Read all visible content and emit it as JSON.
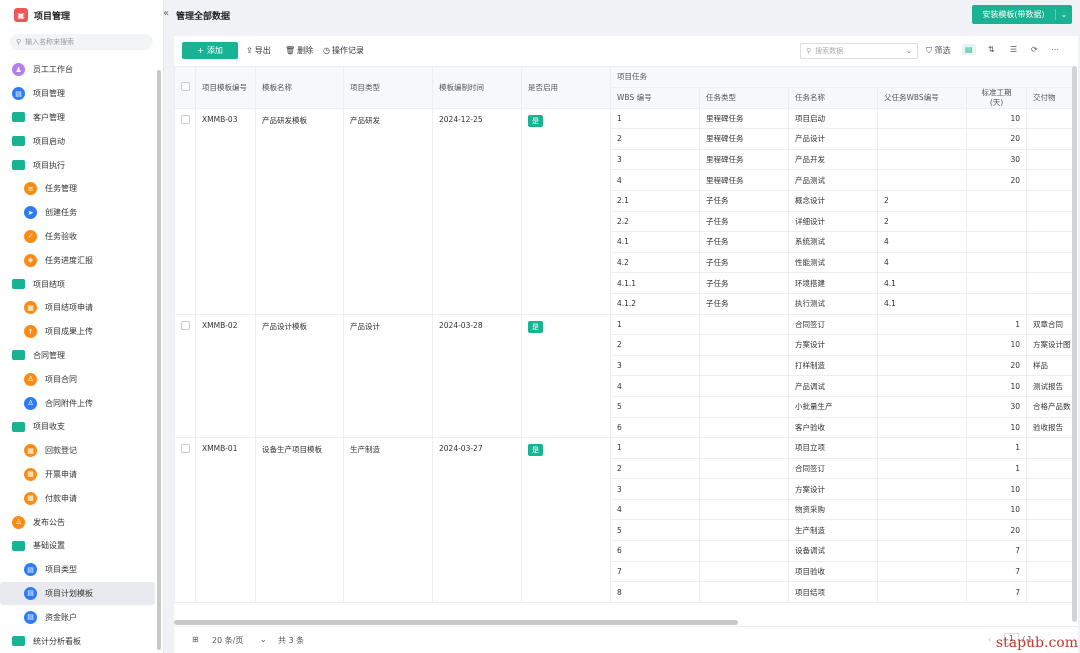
{
  "app": {
    "title": "项目管理",
    "logo_icon": "app-logo-icon"
  },
  "sidebar": {
    "search_placeholder": "输入名称来搜索",
    "items": [
      {
        "label": "员工工作台",
        "icon": "user-icon",
        "color": "purple",
        "level": 0
      },
      {
        "label": "项目管理",
        "icon": "document-icon",
        "color": "blue",
        "level": 0
      },
      {
        "label": "客户管理",
        "icon": "folder-icon",
        "color": "folder",
        "level": 0
      },
      {
        "label": "项目启动",
        "icon": "folder-icon",
        "color": "folder",
        "level": 0
      },
      {
        "label": "项目执行",
        "icon": "folder-icon",
        "color": "folder",
        "level": 0
      },
      {
        "label": "任务管理",
        "icon": "list-icon",
        "color": "orange",
        "level": 1
      },
      {
        "label": "创建任务",
        "icon": "send-icon",
        "color": "blue",
        "level": 1
      },
      {
        "label": "任务验收",
        "icon": "check-icon",
        "color": "orange",
        "level": 1
      },
      {
        "label": "任务进度汇报",
        "icon": "shield-icon",
        "color": "orange",
        "level": 1
      },
      {
        "label": "项目结项",
        "icon": "folder-icon",
        "color": "folder",
        "level": 0
      },
      {
        "label": "项目结项申请",
        "icon": "form-icon",
        "color": "orange",
        "level": 1
      },
      {
        "label": "项目成果上传",
        "icon": "upload-icon",
        "color": "orange",
        "level": 1
      },
      {
        "label": "合同管理",
        "icon": "folder-icon",
        "color": "folder",
        "level": 0
      },
      {
        "label": "项目合同",
        "icon": "person-icon",
        "color": "orange",
        "level": 1
      },
      {
        "label": "合同附件上传",
        "icon": "person-icon",
        "color": "blue",
        "level": 1
      },
      {
        "label": "项目收支",
        "icon": "folder-icon",
        "color": "folder",
        "level": 0
      },
      {
        "label": "回款登记",
        "icon": "form-icon",
        "color": "orange",
        "level": 1
      },
      {
        "label": "开票申请",
        "icon": "form-icon",
        "color": "orange",
        "level": 1
      },
      {
        "label": "付款申请",
        "icon": "form-icon",
        "color": "orange",
        "level": 1
      },
      {
        "label": "发布公告",
        "icon": "person-icon",
        "color": "orange",
        "level": 0
      },
      {
        "label": "基础设置",
        "icon": "folder-icon",
        "color": "folder",
        "level": 0
      },
      {
        "label": "项目类型",
        "icon": "document-icon",
        "color": "blue",
        "level": 1
      },
      {
        "label": "项目计划模板",
        "icon": "document-icon",
        "color": "blue",
        "level": 1,
        "active": true
      },
      {
        "label": "资金账户",
        "icon": "document-icon",
        "color": "blue",
        "level": 1
      },
      {
        "label": "统计分析看板",
        "icon": "folder-icon",
        "color": "folder",
        "level": 0
      }
    ]
  },
  "header": {
    "collapse_glyph": "«",
    "title": "管理全部数据",
    "install_button": "安装模板(带数据)"
  },
  "toolbar": {
    "add": "添加",
    "export": "导出",
    "delete": "删除",
    "log": "操作记录",
    "search_placeholder": "搜索数据",
    "filter": "筛选"
  },
  "table": {
    "headers": {
      "code": "项目模板编号",
      "name": "模板名称",
      "type": "项目类型",
      "date": "模板编制时间",
      "enabled": "是否启用",
      "group": "项目任务",
      "wbs": "WBS 编号",
      "task_type": "任务类型",
      "task_name": "任务名称",
      "parent_wbs": "父任务WBS编号",
      "duration": "标准工期\n(天)",
      "deliverable": "交付物"
    },
    "records": [
      {
        "code": "XMMB-03",
        "name": "产品研发模板",
        "type": "产品研发",
        "date": "2024-12-25",
        "enabled": "是",
        "tasks": [
          [
            "1",
            "里程碑任务",
            "项目启动",
            "",
            "10",
            ""
          ],
          [
            "2",
            "里程碑任务",
            "产品设计",
            "",
            "20",
            ""
          ],
          [
            "3",
            "里程碑任务",
            "产品开发",
            "",
            "30",
            ""
          ],
          [
            "4",
            "里程碑任务",
            "产品测试",
            "",
            "20",
            ""
          ],
          [
            "2.1",
            "子任务",
            "概念设计",
            "2",
            "",
            ""
          ],
          [
            "2.2",
            "子任务",
            "详细设计",
            "2",
            "",
            ""
          ],
          [
            "4.1",
            "子任务",
            "系统测试",
            "4",
            "",
            ""
          ],
          [
            "4.2",
            "子任务",
            "性能测试",
            "4",
            "",
            ""
          ],
          [
            "4.1.1",
            "子任务",
            "环境搭建",
            "4.1",
            "",
            ""
          ],
          [
            "4.1.2",
            "子任务",
            "执行测试",
            "4.1",
            "",
            ""
          ]
        ]
      },
      {
        "code": "XMMB-02",
        "name": "产品设计模板",
        "type": "产品设计",
        "date": "2024-03-28",
        "enabled": "是",
        "tasks": [
          [
            "1",
            "",
            "合同签订",
            "",
            "1",
            "双章合同"
          ],
          [
            "2",
            "",
            "方案设计",
            "",
            "10",
            "方案设计图"
          ],
          [
            "3",
            "",
            "打样制造",
            "",
            "20",
            "样品"
          ],
          [
            "4",
            "",
            "产品调试",
            "",
            "10",
            "测试报告"
          ],
          [
            "5",
            "",
            "小批量生产",
            "",
            "30",
            "合格产品数"
          ],
          [
            "6",
            "",
            "客户验收",
            "",
            "10",
            "验收报告"
          ]
        ]
      },
      {
        "code": "XMMB-01",
        "name": "设备生产项目模板",
        "type": "生产制造",
        "date": "2024-03-27",
        "enabled": "是",
        "tasks": [
          [
            "1",
            "",
            "项目立项",
            "",
            "1",
            ""
          ],
          [
            "2",
            "",
            "合同签订",
            "",
            "1",
            ""
          ],
          [
            "3",
            "",
            "方案设计",
            "",
            "10",
            ""
          ],
          [
            "4",
            "",
            "物资采购",
            "",
            "10",
            ""
          ],
          [
            "5",
            "",
            "生产制造",
            "",
            "20",
            ""
          ],
          [
            "6",
            "",
            "设备调试",
            "",
            "7",
            ""
          ],
          [
            "7",
            "",
            "项目验收",
            "",
            "7",
            ""
          ],
          [
            "8",
            "",
            "项目结项",
            "",
            "7",
            ""
          ]
        ]
      }
    ]
  },
  "pager": {
    "page_size": "20 条/页",
    "total": "共 3 条",
    "current_page": "1",
    "total_pages": "/ 1"
  },
  "watermark": "stapub.com",
  "colors": {
    "accent": "#19b394",
    "orange": "#fa8c16",
    "blue": "#2f7bf6",
    "purple": "#b37feb"
  }
}
